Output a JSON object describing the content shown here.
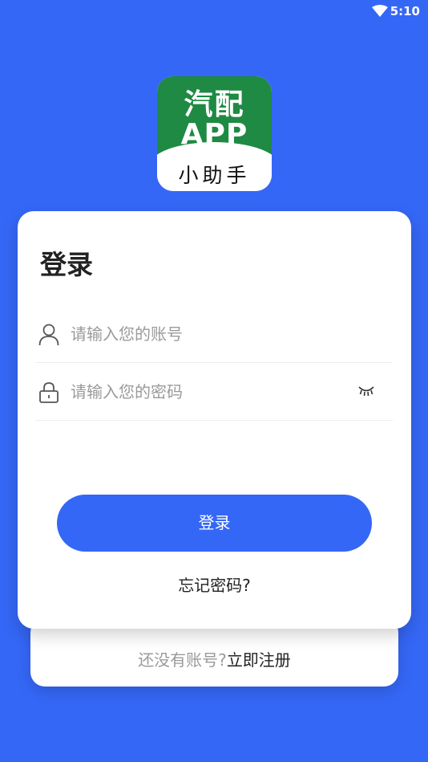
{
  "status_bar": {
    "time": "5:10",
    "wifi_icon": "wifi-icon"
  },
  "logo": {
    "line1": "汽配",
    "line2": "APP",
    "line3": "小助手",
    "green": "#1E8A43"
  },
  "login": {
    "title": "登录",
    "account_placeholder": "请输入您的账号",
    "password_placeholder": "请输入您的密码",
    "submit_label": "登录",
    "forgot_label": "忘记密码?"
  },
  "register": {
    "question": "还没有账号?",
    "link": "立即注册"
  },
  "colors": {
    "primary": "#3567F6",
    "logo_green": "#1E8A43"
  }
}
